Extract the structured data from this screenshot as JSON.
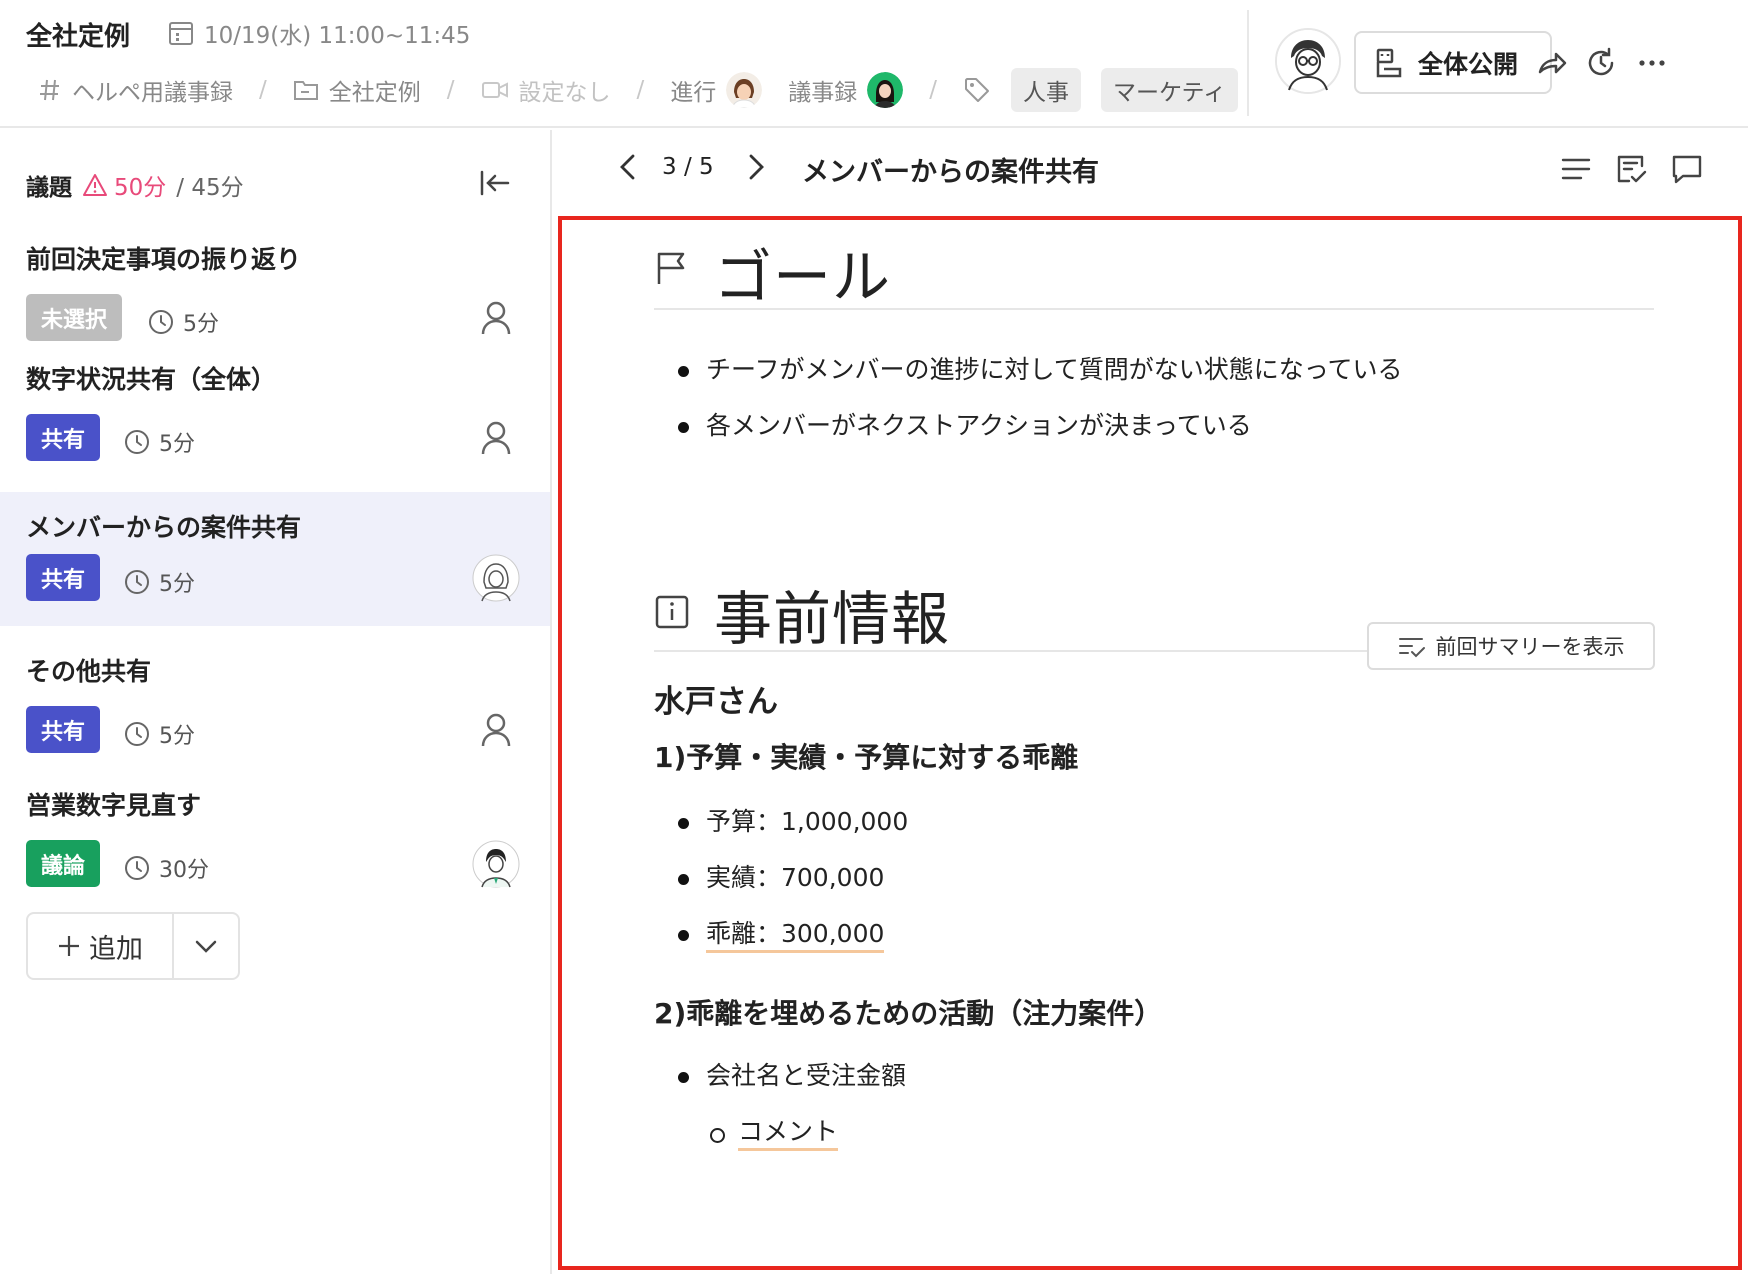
{
  "header": {
    "meeting_title": "全社定例",
    "datetime": "10/19(水) 11:00~11:45",
    "channel": "ヘルペ用議事録",
    "folder": "全社定例",
    "video": "設定なし",
    "facilitator_label": "進行",
    "minutes_label": "議事録",
    "tags": [
      "人事",
      "マーケティ"
    ],
    "publish_label": "全体公開"
  },
  "sidebar": {
    "label": "議題",
    "total_time": "50分",
    "planned_time": "/ 45分",
    "items": [
      {
        "title": "前回決定事項の振り返り",
        "badge": "未選択",
        "badge_color": "#bdbdbd",
        "time": "5分"
      },
      {
        "title": "数字状況共有（全体）",
        "badge": "共有",
        "badge_color": "#4a52c9",
        "time": "5分"
      },
      {
        "title": "メンバーからの案件共有",
        "badge": "共有",
        "badge_color": "#4a52c9",
        "time": "5分",
        "active": true
      },
      {
        "title": "その他共有",
        "badge": "共有",
        "badge_color": "#4a52c9",
        "time": "5分"
      },
      {
        "title": "営業数字見直す",
        "badge": "議論",
        "badge_color": "#18a05e",
        "time": "30分"
      }
    ],
    "add_label": "追加"
  },
  "main": {
    "page_counter": "3 / 5",
    "title": "メンバーからの案件共有",
    "goal": {
      "heading": "ゴール",
      "bullets": [
        "チーフがメンバーの進捗に対して質問がない状態になっている",
        "各メンバーがネクストアクションが決まっている"
      ]
    },
    "preinfo": {
      "heading": "事前情報",
      "summary_button": "前回サマリーを表示",
      "person": "水戸さん",
      "section1": {
        "heading": "1)予算・実績・予算に対する乖離",
        "bullets": [
          "予算：1,000,000",
          "実績：700,000",
          "乖離：300,000"
        ]
      },
      "section2": {
        "heading": "2)乖離を埋めるための活動（注力案件）",
        "bullet": "会社名と受注金額",
        "sub_bullet": "コメント"
      }
    }
  },
  "colors": {
    "accent_red": "#e8261e",
    "warn_pink": "#e84a7a",
    "active_row": "#eff0fa",
    "underline": "#f5c79b"
  }
}
